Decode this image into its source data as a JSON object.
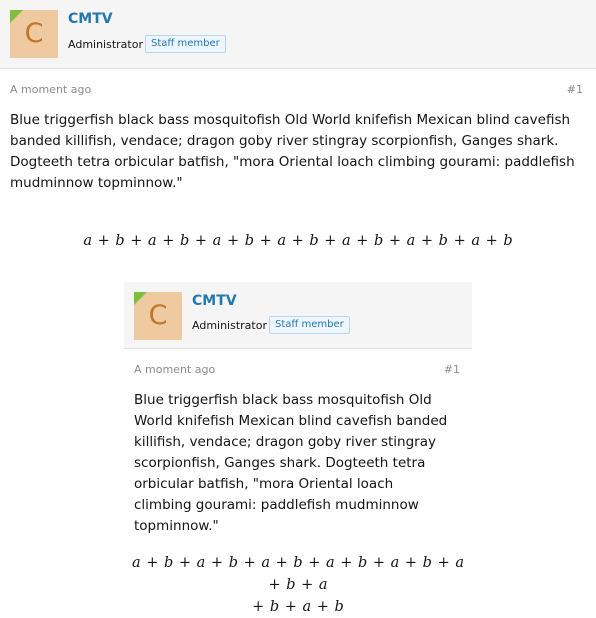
{
  "posts": [
    {
      "avatar_letter": "C",
      "username": "CMTV",
      "role": "Administrator",
      "badge": "Staff member",
      "time": "A moment ago",
      "number": "#1",
      "body": "Blue triggerfish black bass mosquitofish Old World knifefish Mexican blind cavefish banded killifish, vendace; dragon goby river stingray scorpionfish, Ganges shark. Dogteeth tetra orbicular batfish, \"mora Oriental loach climbing gourami: paddlefish mudminnow topminnow.\"",
      "math": "a + b + a + b + a + b + a + b + a + b + a + b + a + b",
      "math_line2": ""
    },
    {
      "avatar_letter": "C",
      "username": "CMTV",
      "role": "Administrator",
      "badge": "Staff member",
      "time": "A moment ago",
      "number": "#1",
      "body": "Blue triggerfish black bass mosquitofish Old World knifefish Mexican blind cavefish banded killifish, vendace; dragon goby river stingray scorpionfish, Ganges shark. Dogteeth tetra orbicular batfish, \"mora Oriental loach climbing gourami: paddlefish mudminnow topminnow.\"",
      "math": "a + b + a + b + a + b + a + b + a + b + a + b + a",
      "math_line2": "+ b + a + b"
    }
  ]
}
